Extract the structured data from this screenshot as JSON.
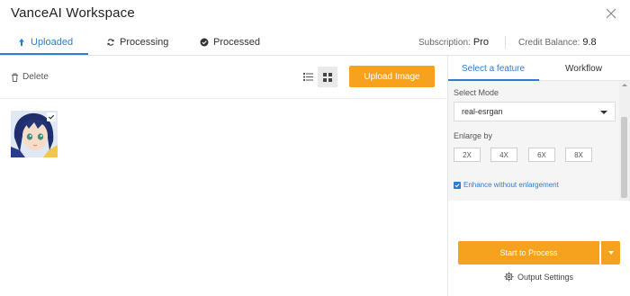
{
  "app": {
    "title": "VanceAI Workspace"
  },
  "tabs": [
    {
      "label": "Uploaded",
      "icon": "upload-arrow-icon",
      "active": true
    },
    {
      "label": "Processing",
      "icon": "refresh-icon",
      "active": false
    },
    {
      "label": "Processed",
      "icon": "check-circle-icon",
      "active": false
    }
  ],
  "subscription": {
    "label": "Subscription:",
    "value": "Pro"
  },
  "credit": {
    "label": "Credit Balance:",
    "value": "9.8"
  },
  "toolbar": {
    "delete_label": "Delete",
    "upload_label": "Upload Image",
    "view_mode": "grid"
  },
  "images": [
    {
      "name": "anime-portrait",
      "selected": true
    }
  ],
  "right_panel": {
    "tabs": [
      {
        "label": "Select a feature",
        "active": true
      },
      {
        "label": "Workflow",
        "active": false
      }
    ],
    "select_mode_label": "Select Mode",
    "mode_value": "real-esrgan",
    "enlarge_label": "Enlarge by",
    "scales": [
      "2X",
      "4X",
      "6X",
      "8X"
    ],
    "enhance_label": "Enhance without enlargement",
    "enhance_checked": true,
    "start_label": "Start to Process",
    "output_settings_label": "Output Settings"
  },
  "colors": {
    "accent": "#2d7bd3",
    "primary_button": "#f6a21e"
  }
}
